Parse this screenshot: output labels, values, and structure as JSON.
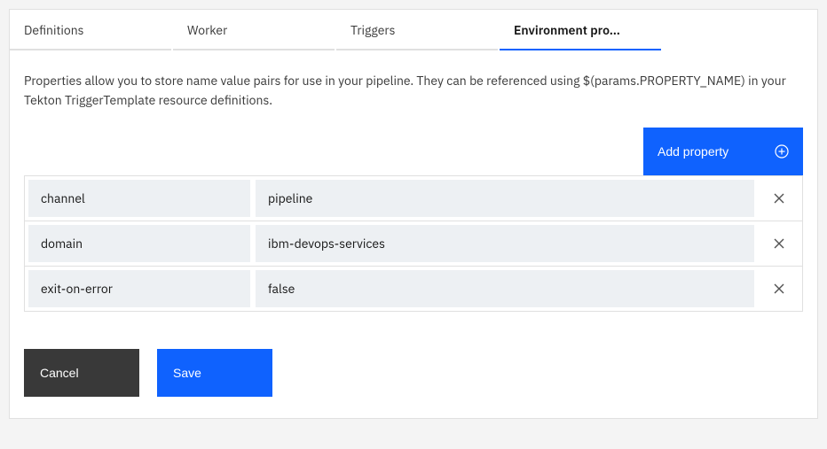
{
  "tabs": [
    {
      "label": "Definitions",
      "active": false
    },
    {
      "label": "Worker",
      "active": false
    },
    {
      "label": "Triggers",
      "active": false
    },
    {
      "label": "Environment pro…",
      "active": true
    }
  ],
  "description": "Properties allow you to store name value pairs for use in your pipeline. They can be referenced using $(params.PROPERTY_NAME) in your Tekton TriggerTemplate resource definitions.",
  "add_property_label": "Add property",
  "properties": [
    {
      "key": "channel",
      "value": "pipeline"
    },
    {
      "key": "domain",
      "value": "ibm-devops-services"
    },
    {
      "key": "exit-on-error",
      "value": "false"
    }
  ],
  "buttons": {
    "cancel": "Cancel",
    "save": "Save"
  },
  "colors": {
    "primary": "#0f62fe",
    "secondary": "#393939",
    "field_bg": "#edf0f3"
  }
}
